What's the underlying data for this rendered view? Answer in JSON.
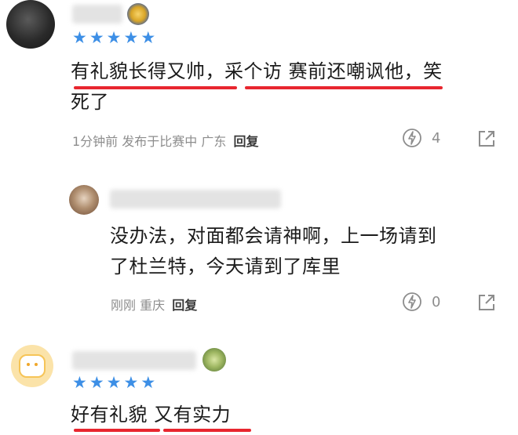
{
  "comments": [
    {
      "rating_stars": 5,
      "text_line1": "有礼貌长得又帅，采个访 赛前还嘲讽他，笑",
      "text_line2": "死了",
      "meta_time": "1分钟前 发布于比赛中 广东",
      "reply_label": "回复",
      "likes": "4"
    },
    {
      "text_line1": "没办法，对面都会请神啊，上一场请到",
      "text_line2": "了杜兰特，今天请到了库里",
      "meta_time": "刚刚 重庆",
      "reply_label": "回复",
      "likes": "0"
    },
    {
      "rating_stars": 5,
      "text_line1": "好有礼貌 又有实力"
    }
  ],
  "colors": {
    "star": "#3d8fe6",
    "underline": "#e8262f"
  },
  "icons": {
    "like": "lightbulb-icon",
    "share": "share-icon",
    "star": "star-icon"
  }
}
